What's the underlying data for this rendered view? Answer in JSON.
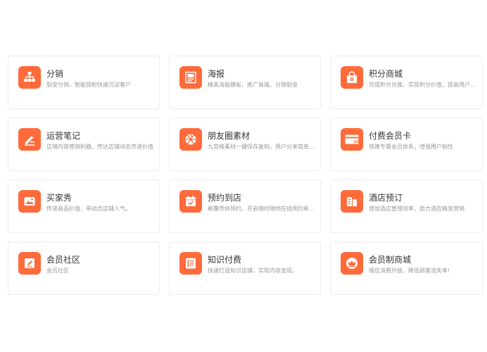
{
  "accent_color": "#ff6a3a",
  "cards": [
    {
      "title": "分销",
      "desc": "裂变分销，智能锁粉快速沉淀客户",
      "icon": "distribution-icon"
    },
    {
      "title": "海报",
      "desc": "精美海报模板，推广商城、分销裂变",
      "icon": "poster-icon"
    },
    {
      "title": "积分商城",
      "desc": "完成积分兑换，实现积分价值，提高用户粘性",
      "icon": "points-mall-icon"
    },
    {
      "title": "运营笔记",
      "desc": "店铺内容营销利器，传达店铺动态传递价值",
      "icon": "notes-icon"
    },
    {
      "title": "朋友圈素材",
      "desc": "九宫格素材一键保存复制，用户分享简单高效",
      "icon": "moments-icon"
    },
    {
      "title": "付费会员卡",
      "desc": "搭建专属会员体系，增强用户粘性",
      "icon": "vip-card-icon"
    },
    {
      "title": "买家秀",
      "desc": "传递商品价值，带动点店铺人气。",
      "icon": "buyer-show-icon"
    },
    {
      "title": "预约到店",
      "desc": "颠覆传统预约，开启随时随地在线预约新模式",
      "icon": "appointment-icon"
    },
    {
      "title": "酒店预订",
      "desc": "增加酒店管理效率，助力酒店精准营销",
      "icon": "hotel-icon"
    },
    {
      "title": "会员社区",
      "desc": "会员社区",
      "icon": "community-icon"
    },
    {
      "title": "知识付费",
      "desc": "快速打造知识店铺，实现内容变现。",
      "icon": "knowledge-icon"
    },
    {
      "title": "会员制商城",
      "desc": "顺应消费升级，降低顾客流失率!",
      "icon": "member-mall-icon"
    }
  ]
}
